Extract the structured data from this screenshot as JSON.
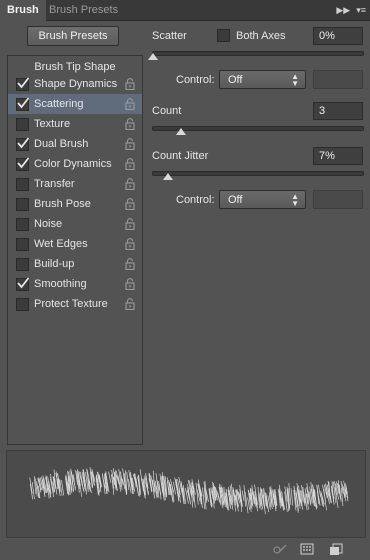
{
  "tabs": [
    {
      "label": "Brush",
      "active": true
    },
    {
      "label": "Brush Presets",
      "active": false
    }
  ],
  "panel_menu_icons": [
    "double-arrow-icon",
    "panel-menu-icon"
  ],
  "brush_presets_button": "Brush Presets",
  "brush_tip_shape": "Brush Tip Shape",
  "options": [
    {
      "label": "Shape Dynamics",
      "checked": true,
      "selected": false
    },
    {
      "label": "Scattering",
      "checked": true,
      "selected": true
    },
    {
      "label": "Texture",
      "checked": false,
      "selected": false
    },
    {
      "label": "Dual Brush",
      "checked": true,
      "selected": false
    },
    {
      "label": "Color Dynamics",
      "checked": true,
      "selected": false
    },
    {
      "label": "Transfer",
      "checked": false,
      "selected": false
    },
    {
      "label": "Brush Pose",
      "checked": false,
      "selected": false
    },
    {
      "label": "Noise",
      "checked": false,
      "selected": false
    },
    {
      "label": "Wet Edges",
      "checked": false,
      "selected": false
    },
    {
      "label": "Build-up",
      "checked": false,
      "selected": false
    },
    {
      "label": "Smoothing",
      "checked": true,
      "selected": false
    },
    {
      "label": "Protect Texture",
      "checked": false,
      "selected": false
    }
  ],
  "scatter": {
    "label": "Scatter",
    "both_axes_label": "Both Axes",
    "both_axes_checked": false,
    "value": "0%",
    "slider_fraction": 0.0,
    "control_label": "Control:",
    "control_value": "Off"
  },
  "count": {
    "label": "Count",
    "value": "3",
    "slider_fraction": 0.133
  },
  "count_jitter": {
    "label": "Count Jitter",
    "value": "7%",
    "slider_fraction": 0.07,
    "control_label": "Control:",
    "control_value": "Off"
  },
  "footer_icons": [
    "toggle-preview-icon",
    "grid-icon",
    "new-brush-icon"
  ],
  "colors": {
    "panel_bg": "#535353",
    "tabbar_bg": "#393939",
    "selected_row": "#606c7c"
  }
}
